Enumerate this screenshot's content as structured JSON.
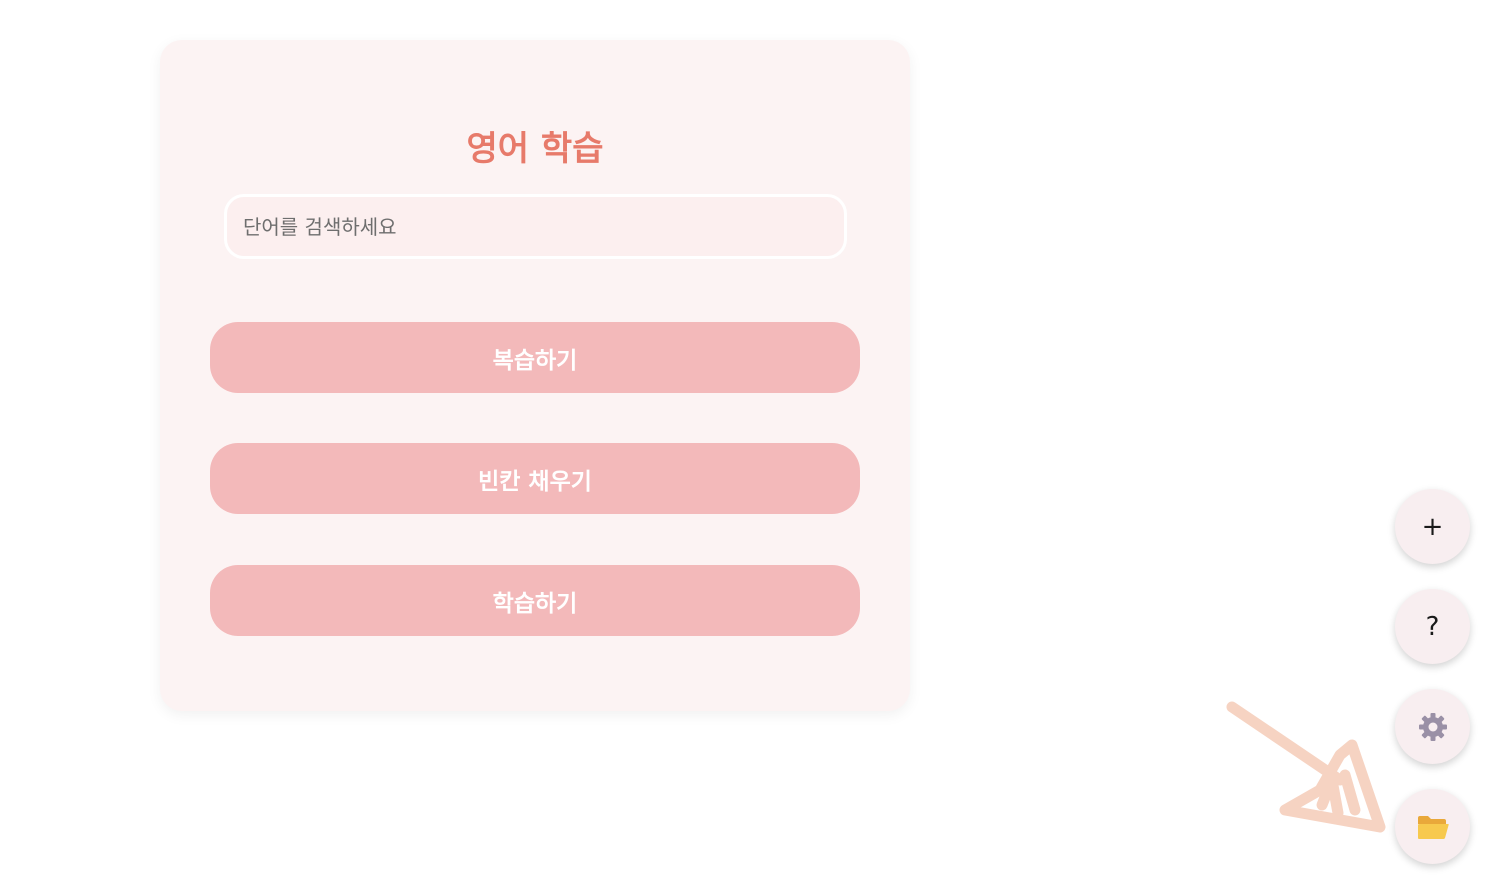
{
  "header": {
    "title": "영어 학습"
  },
  "search": {
    "placeholder": "단어를 검색하세요",
    "value": ""
  },
  "menu": {
    "review_label": "복습하기",
    "fill_blank_label": "빈칸 채우기",
    "study_label": "학습하기"
  },
  "fabs": {
    "add_label": "+",
    "help_label": "?",
    "settings_icon": "gear-icon",
    "folder_icon": "folder-icon"
  },
  "colors": {
    "title": "#e77a6a",
    "card_bg": "#fcf3f3",
    "button_bg": "#f3b9ba",
    "fab_bg": "#f8eef0",
    "annotation": "#f6d3c2"
  }
}
